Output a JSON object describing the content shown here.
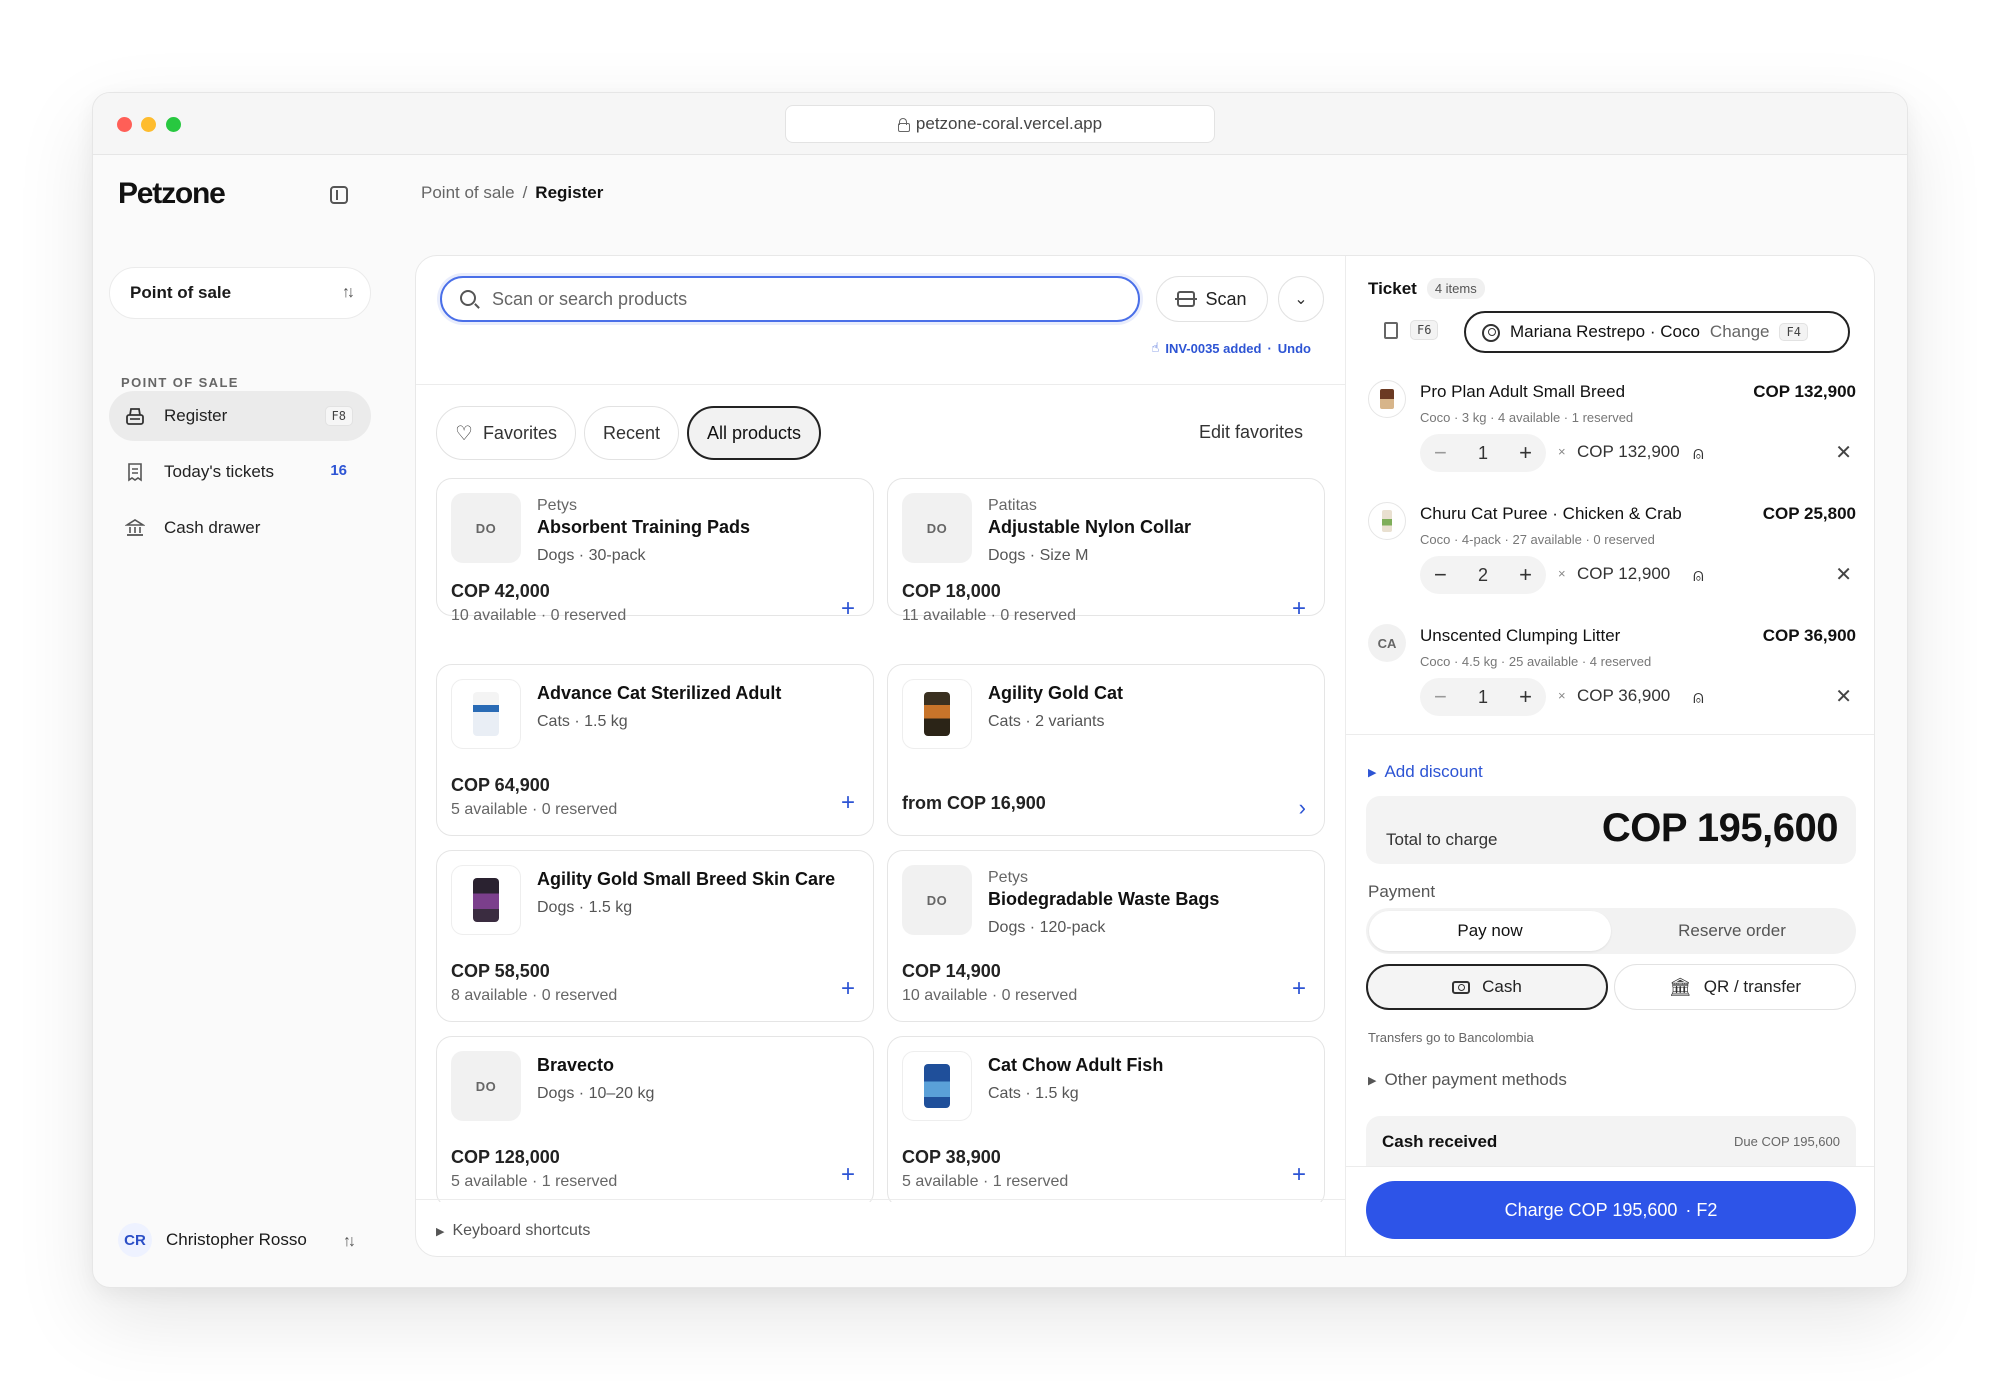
{
  "browser": {
    "url": "petzone-coral.vercel.app"
  },
  "sidebar": {
    "logo": "Petzone",
    "org_switch": "Point of sale",
    "section_label": "POINT OF SALE",
    "items": [
      {
        "label": "Register",
        "shortcut": "F8",
        "icon": "register-icon"
      },
      {
        "label": "Today's tickets",
        "count": "16",
        "icon": "receipt-icon"
      },
      {
        "label": "Cash drawer",
        "icon": "bank-icon"
      }
    ],
    "user": {
      "initials": "CR",
      "name": "Christopher Rosso"
    }
  },
  "breadcrumb": {
    "parent": "Point of sale",
    "separator": "/",
    "current": "Register"
  },
  "search": {
    "placeholder": "Scan or search products",
    "value": ""
  },
  "scan_label": "Scan",
  "toast": {
    "text": "INV-0035 added",
    "sep": "·",
    "action": "Undo"
  },
  "tabs": [
    {
      "label": "Favorites",
      "icon": "heart-icon"
    },
    {
      "label": "Recent"
    },
    {
      "label": "All products",
      "active": true
    }
  ],
  "edit_favorites": "Edit favorites",
  "products": [
    {
      "brand": "Petys",
      "name": "Absorbent Training Pads",
      "meta": "Dogs · 30-pack",
      "price": "COP 42,000",
      "avail": "10 available · 0 reserved",
      "thumb": "DO"
    },
    {
      "brand": "Patitas",
      "name": "Adjustable Nylon Collar",
      "meta": "Dogs · Size M",
      "price": "COP 18,000",
      "avail": "11 available · 0 reserved",
      "thumb": "DO"
    },
    {
      "brand": "",
      "name": "Advance Cat Sterilized Adult",
      "meta": "Cats · 1.5 kg",
      "price": "COP 64,900",
      "avail": "5 available · 0 reserved",
      "thumb": ""
    },
    {
      "brand": "",
      "name": "Agility Gold Cat",
      "meta": "Cats · 2 variants",
      "price": "from COP 16,900",
      "avail": "",
      "thumb": ""
    },
    {
      "brand": "",
      "name": "Agility Gold Small Breed Skin Care",
      "meta": "Dogs · 1.5 kg",
      "price": "COP 58,500",
      "avail": "8 available · 0 reserved",
      "thumb": ""
    },
    {
      "brand": "Petys",
      "name": "Biodegradable Waste Bags",
      "meta": "Dogs · 120-pack",
      "price": "COP 14,900",
      "avail": "10 available · 0 reserved",
      "thumb": "DO"
    },
    {
      "brand": "",
      "name": "Bravecto",
      "meta": "Dogs · 10–20 kg",
      "price": "COP 128,000",
      "avail": "5 available · 1 reserved",
      "thumb": "DO"
    },
    {
      "brand": "",
      "name": "Cat Chow Adult Fish",
      "meta": "Cats · 1.5 kg",
      "price": "COP 38,900",
      "avail": "5 available · 1 reserved",
      "thumb": ""
    }
  ],
  "keyboard_shortcuts": "Keyboard shortcuts",
  "ticket": {
    "title": "Ticket",
    "count": "4 items",
    "f6": "F6",
    "customer": "Mariana Restrepo · Coco",
    "change": "Change",
    "f4": "F4",
    "lines": [
      {
        "name": "Pro Plan Adult Small Breed",
        "meta": "Coco · 3 kg · 4 available · 1 reserved",
        "total": "COP 132,900",
        "qty": "1",
        "unit": "COP 132,900",
        "thumb": ""
      },
      {
        "name": "Churu Cat Puree · Chicken & Crab",
        "meta": "Coco · 4-pack · 27 available · 0 reserved",
        "total": "COP 25,800",
        "qty": "2",
        "unit": "COP 12,900",
        "thumb": ""
      },
      {
        "name": "Unscented Clumping Litter",
        "meta": "Coco · 4.5 kg · 25 available · 4 reserved",
        "total": "COP 36,900",
        "qty": "1",
        "unit": "COP 36,900",
        "thumb": "CA"
      }
    ],
    "times": "×",
    "add_discount": "Add discount",
    "total_label": "Total to charge",
    "total_value": "COP 195,600",
    "payment_label": "Payment",
    "pay_now": "Pay now",
    "reserve": "Reserve order",
    "cash": "Cash",
    "qr": "QR / transfer",
    "transfers_note": "Transfers go to Bancolombia",
    "other_methods": "Other payment methods",
    "cash_received": "Cash received",
    "due": "Due COP 195,600",
    "charge": "Charge COP 195,600",
    "charge_key": "· F2"
  },
  "colors": {
    "accent": "#2d54e8",
    "link": "#2d54d4"
  }
}
